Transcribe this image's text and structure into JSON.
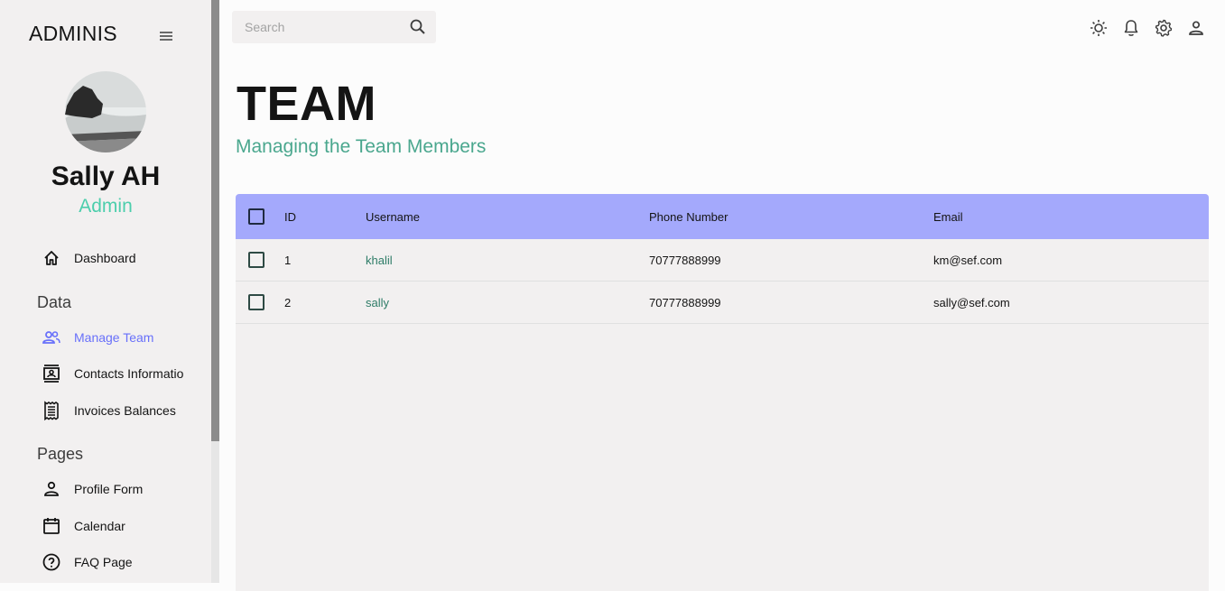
{
  "sidebar": {
    "brand": "ADMINIS",
    "user": {
      "name": "Sally AH",
      "role": "Admin"
    },
    "items": [
      {
        "label": "Dashboard",
        "icon": "home-icon"
      },
      {
        "label": "Manage Team",
        "icon": "people-icon",
        "active": true
      },
      {
        "label": "Contacts Information",
        "icon": "contacts-icon"
      },
      {
        "label": "Invoices Balances",
        "icon": "receipt-icon"
      },
      {
        "label": "Profile Form",
        "icon": "person-icon"
      },
      {
        "label": "Calendar",
        "icon": "calendar-icon"
      },
      {
        "label": "FAQ Page",
        "icon": "help-circle-icon"
      }
    ],
    "sections": {
      "data": "Data",
      "pages": "Pages"
    }
  },
  "topbar": {
    "search": {
      "placeholder": "Search",
      "value": ""
    },
    "icons": [
      "light-mode-icon",
      "notifications-icon",
      "settings-icon",
      "person-icon"
    ]
  },
  "header": {
    "title": "TEAM",
    "subtitle": "Managing the Team Members"
  },
  "table": {
    "columns": [
      "ID",
      "Username",
      "Phone Number",
      "Email"
    ],
    "rows": [
      {
        "id": "1",
        "username": "khalil",
        "phone": "70777888999",
        "email": "km@sef.com"
      },
      {
        "id": "2",
        "username": "sally",
        "phone": "70777888999",
        "email": "sally@sef.com"
      }
    ]
  },
  "colors": {
    "accent": "#6870fa",
    "green_accent": "#4cceac",
    "header_bg": "#a4a9fc",
    "sidebar_bg": "#f2f0f0"
  }
}
